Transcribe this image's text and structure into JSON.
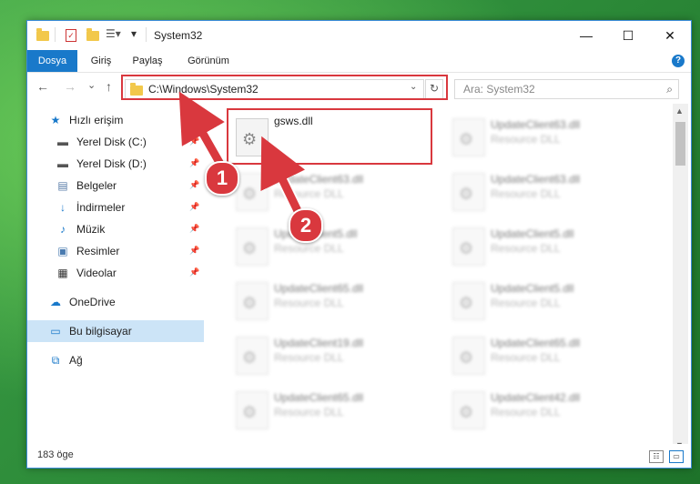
{
  "window": {
    "title": "System32",
    "controls": {
      "minimize": "—",
      "maximize": "☐",
      "close": "✕"
    }
  },
  "ribbon": {
    "tabs": [
      {
        "label": "Dosya",
        "active": true
      },
      {
        "label": "Giriş",
        "active": false
      },
      {
        "label": "Paylaş",
        "active": false
      },
      {
        "label": "Görünüm",
        "active": false
      }
    ],
    "help": "?"
  },
  "navigation": {
    "back": "←",
    "forward": "→",
    "recent": "⌄",
    "up": "↑",
    "address": "C:\\Windows\\System32",
    "address_dropdown": "⌄",
    "refresh": "↻",
    "search_placeholder": "Ara: System32",
    "search_icon": "⌕"
  },
  "sidebar": {
    "items": [
      {
        "label": "Hızlı erişim",
        "icon": "star-icon",
        "glyph": "★",
        "color": "#1979ca",
        "pinned": false
      },
      {
        "label": "Yerel Disk (C:)",
        "icon": "drive-icon",
        "glyph": "▬",
        "color": "#555555",
        "pinned": true
      },
      {
        "label": "Yerel Disk (D:)",
        "icon": "drive-icon",
        "glyph": "▬",
        "color": "#555555",
        "pinned": true
      },
      {
        "label": "Belgeler",
        "icon": "documents-icon",
        "glyph": "▤",
        "color": "#5a7da8",
        "pinned": true
      },
      {
        "label": "İndirmeler",
        "icon": "downloads-icon",
        "glyph": "↓",
        "color": "#1979ca",
        "pinned": true
      },
      {
        "label": "Müzik",
        "icon": "music-icon",
        "glyph": "♪",
        "color": "#1979ca",
        "pinned": true
      },
      {
        "label": "Resimler",
        "icon": "pictures-icon",
        "glyph": "▣",
        "color": "#4a7bb0",
        "pinned": true
      },
      {
        "label": "Videolar",
        "icon": "videos-icon",
        "glyph": "▦",
        "color": "#333333",
        "pinned": true
      },
      {
        "label": "OneDrive",
        "icon": "onedrive-icon",
        "glyph": "☁",
        "color": "#1979ca",
        "pinned": false
      },
      {
        "label": "Bu bilgisayar",
        "icon": "computer-icon",
        "glyph": "▭",
        "color": "#1979ca",
        "pinned": false,
        "selected": true
      },
      {
        "label": "Ağ",
        "icon": "network-icon",
        "glyph": "⧉",
        "color": "#1979ca",
        "pinned": false
      }
    ],
    "pin_glyph": "📌"
  },
  "files": {
    "selected": {
      "name": "gsws.dll"
    },
    "blurred": [
      {
        "name": "UpdateClient63.dll",
        "type": "Resource DLL"
      },
      {
        "name": "UpdateClient63.dll",
        "type": "Resource DLL"
      },
      {
        "name": "UpdateClient63.dll",
        "type": "Resource DLL"
      },
      {
        "name": "UpdateClient5.dll",
        "type": "Resource DLL"
      },
      {
        "name": "UpdateClient5.dll",
        "type": "Resource DLL"
      },
      {
        "name": "UpdateClient65.dll",
        "type": "Resource DLL"
      },
      {
        "name": "UpdateClient5.dll",
        "type": "Resource DLL"
      },
      {
        "name": "UpdateClient19.dll",
        "type": "Resource DLL"
      },
      {
        "name": "UpdateClient65.dll",
        "type": "Resource DLL"
      },
      {
        "name": "UpdateClient65.dll",
        "type": "Resource DLL"
      },
      {
        "name": "UpdateClient42.dll",
        "type": "Resource DLL"
      }
    ]
  },
  "status": {
    "count": "183 öge"
  },
  "callouts": [
    {
      "number": "1"
    },
    {
      "number": "2"
    }
  ],
  "colors": {
    "accent": "#1979ca",
    "highlight": "#d9383e",
    "selected_bg": "#cce4f7"
  }
}
